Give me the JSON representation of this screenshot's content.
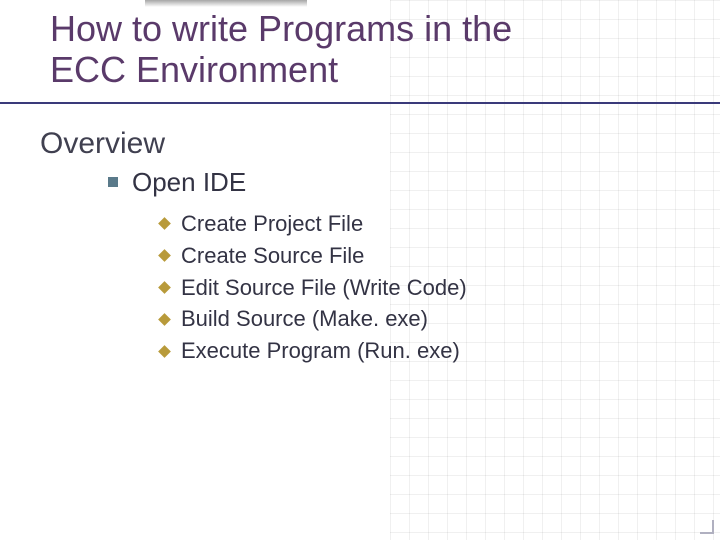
{
  "title_line1": "How to write Programs in the",
  "title_line2": "ECC Environment",
  "overview": "Overview",
  "level1": "Open IDE",
  "items": [
    "Create Project File",
    "Create Source File",
    "Edit Source File (Write Code)",
    "Build Source (Make. exe)",
    "Execute Program (Run. exe)"
  ]
}
